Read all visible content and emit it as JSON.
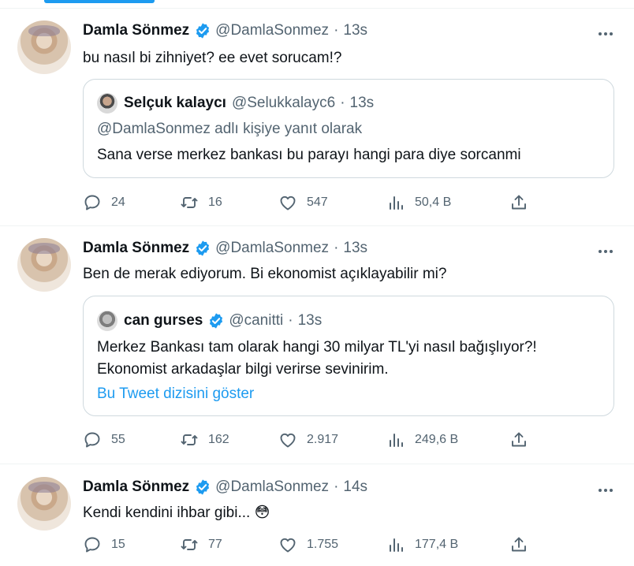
{
  "tweets": [
    {
      "author": "Damla Sönmez",
      "handle": "@DamlaSonmez",
      "time": "13s",
      "text": "bu nasıl bi zihniyet? ee evet sorucam!?",
      "quote": {
        "author": "Selçuk kalaycı",
        "handle": "@Selukkalayc6",
        "time": "13s",
        "reply_to": "@DamlaSonmez adlı kişiye yanıt olarak",
        "body": "Sana verse merkez bankası bu parayı hangi para diye sorcanmi"
      },
      "stats": {
        "replies": "24",
        "retweets": "16",
        "likes": "547",
        "views": "50,4 B"
      }
    },
    {
      "author": "Damla Sönmez",
      "handle": "@DamlaSonmez",
      "time": "13s",
      "text": "Ben de merak ediyorum. Bi ekonomist açıklayabilir mi?",
      "quote": {
        "author": "can gurses",
        "handle": "@canitti",
        "time": "13s",
        "body_line1": "Merkez Bankası tam olarak hangi 30 milyar TL'yi nasıl bağışlıyor?!",
        "body_line2": "Ekonomist arkadaşlar bilgi verirse sevinirim.",
        "show_thread": "Bu Tweet dizisini göster"
      },
      "stats": {
        "replies": "55",
        "retweets": "162",
        "likes": "2.917",
        "views": "249,6 B"
      }
    },
    {
      "author": "Damla Sönmez",
      "handle": "@DamlaSonmez",
      "time": "14s",
      "text": "Kendi kendini ihbar gibi... 😳",
      "stats": {
        "replies": "15",
        "retweets": "77",
        "likes": "1.755",
        "views": "177,4 B"
      }
    }
  ],
  "icons": {
    "verified": "verified-badge-icon",
    "more": "more-icon",
    "reply": "reply-icon",
    "retweet": "retweet-icon",
    "like": "heart-icon",
    "views": "views-chart-icon",
    "share": "share-icon"
  },
  "colors": {
    "accent": "#1d9bf0",
    "secondary_text": "#536471",
    "border": "#cfd9de"
  }
}
